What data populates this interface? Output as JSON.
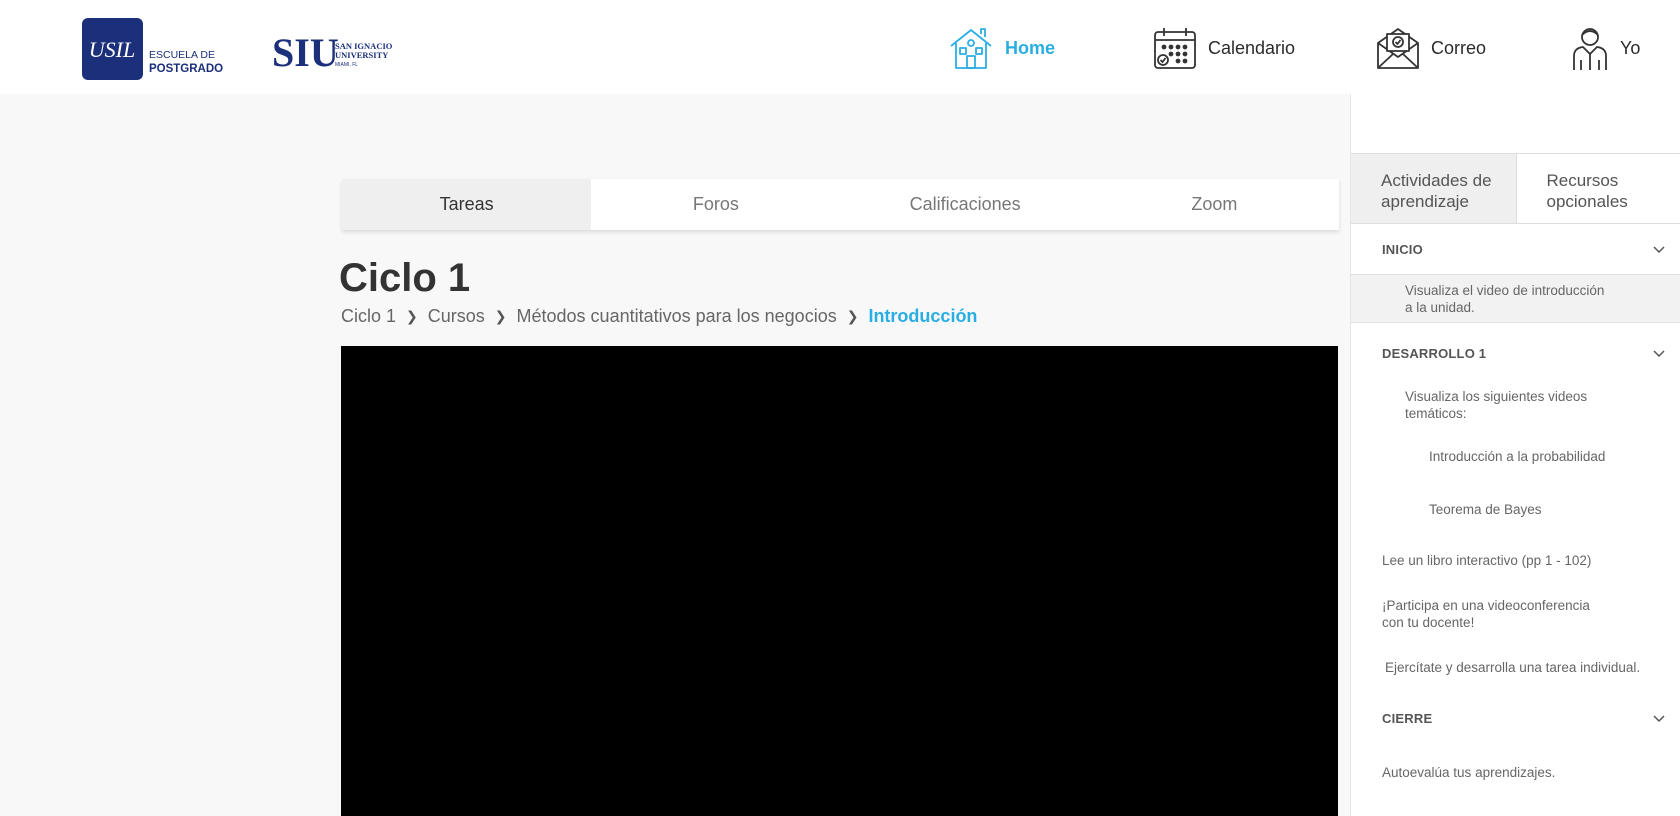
{
  "header": {
    "logo_usil": {
      "mark": "USIL",
      "line1": "ESCUELA DE",
      "line2": "POSTGRADO"
    },
    "logo_siu": {
      "mark": "SIU",
      "line1": "SAN IGNACIO",
      "line2": "UNIVERSITY",
      "line3": "MIAMI, FL"
    },
    "nav": [
      {
        "label": "Home",
        "icon": "home-icon",
        "active": true
      },
      {
        "label": "Calendario",
        "icon": "calendar-icon"
      },
      {
        "label": "Correo",
        "icon": "mail-icon"
      },
      {
        "label": "Yo",
        "icon": "user-icon"
      }
    ],
    "active_color": "#29aee3"
  },
  "tabs": [
    "Tareas",
    "Foros",
    "Calificaciones",
    "Zoom"
  ],
  "page": {
    "title": "Ciclo 1",
    "breadcrumb": [
      "Ciclo 1",
      "Cursos",
      "Métodos cuantitativos para los negocios",
      "Introducción"
    ]
  },
  "sidebar": {
    "tabs": [
      {
        "line1": "Actividades de",
        "line2": "aprendizaje"
      },
      {
        "line1": "Recursos",
        "line2": "opcionales"
      }
    ],
    "sections": {
      "inicio": "INICIO",
      "desarrollo": "DESARROLLO 1",
      "cierre": "CIERRE"
    },
    "items": {
      "video_intro": {
        "line1": "Visualiza el video de introducción",
        "line2": "a la unidad."
      },
      "videos_tematicos": {
        "line1": "Visualiza los siguientes videos",
        "line2": "temáticos:"
      },
      "probabilidad": "Introducción a la probabilidad",
      "bayes": "Teorema de Bayes",
      "libro": "Lee un libro interactivo (pp 1 - 102)",
      "videoconf": {
        "line1": "¡Participa en una videoconferencia",
        "line2": "con tu docente!"
      },
      "tarea": "Ejercítate y desarrolla una tarea individual.",
      "autoevalua": "Autoevalúa tus aprendizajes."
    }
  }
}
